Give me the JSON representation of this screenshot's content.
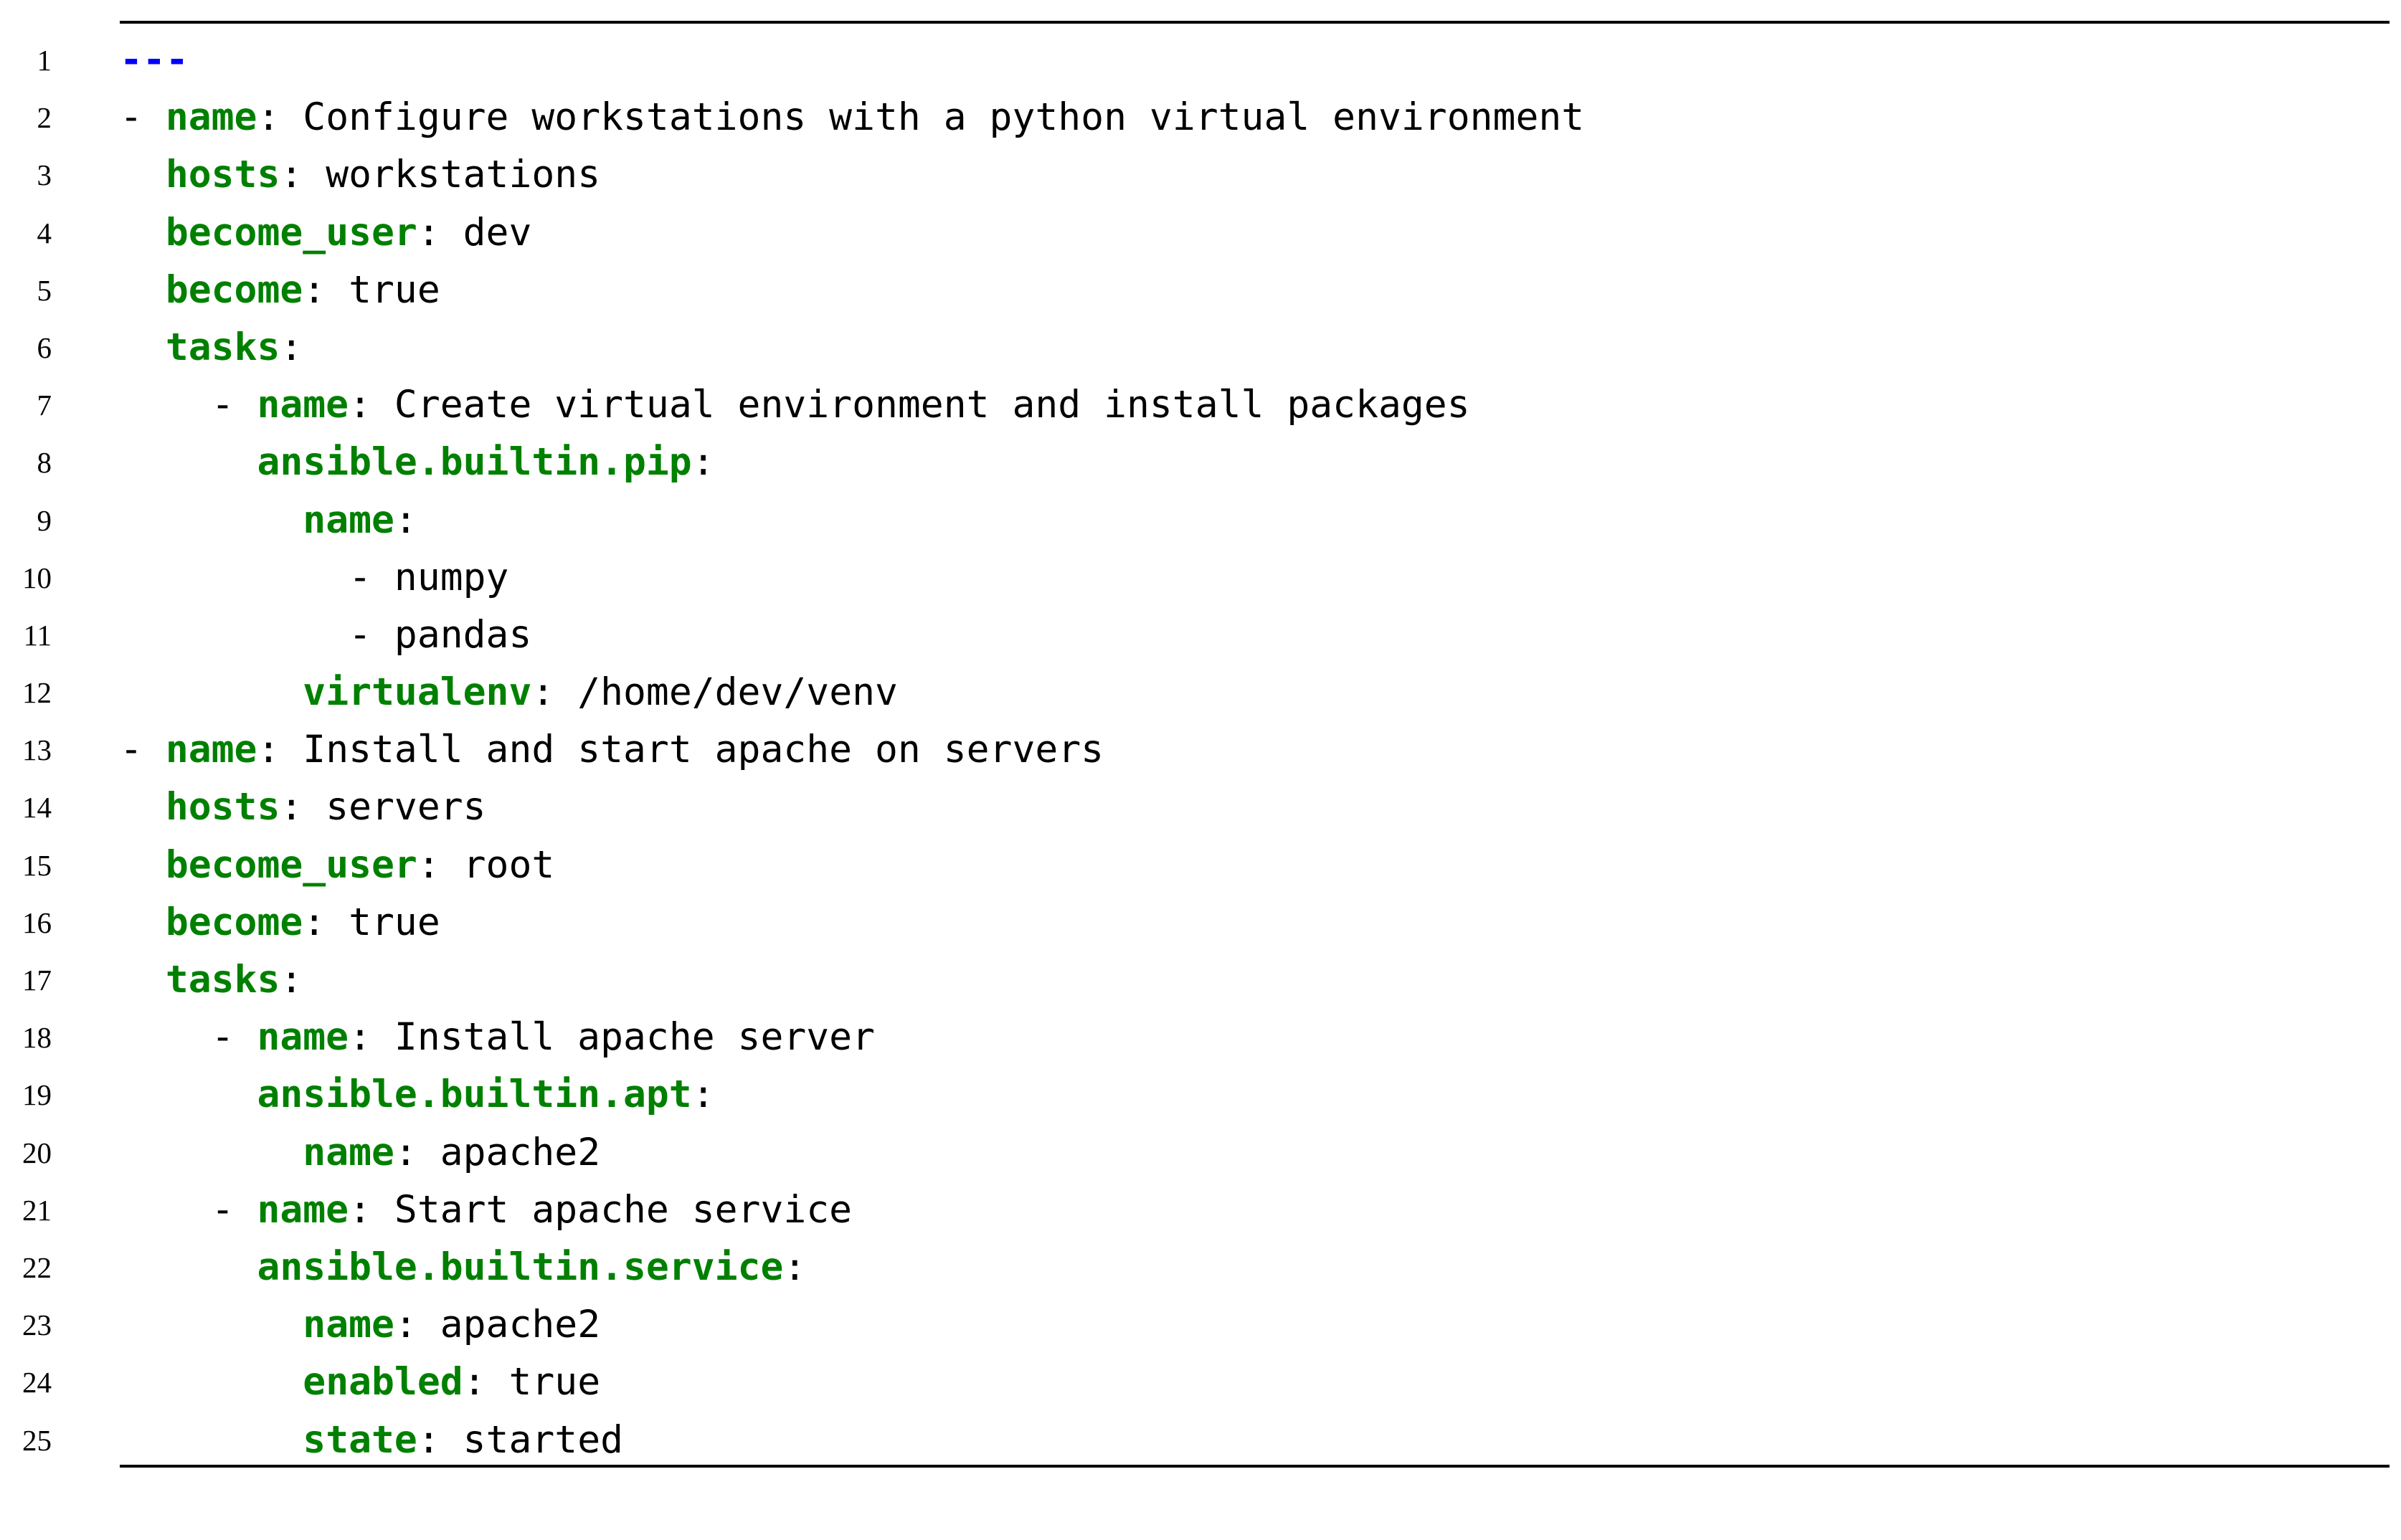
{
  "colors": {
    "key": "#008000",
    "document_marker": "#0000ff",
    "text": "#000000"
  },
  "code_listing": {
    "language": "yaml",
    "lines": [
      {
        "no": "1",
        "tokens": [
          {
            "t": "doc",
            "v": "---"
          }
        ]
      },
      {
        "no": "2",
        "tokens": [
          {
            "t": "plain",
            "v": "- "
          },
          {
            "t": "key",
            "v": "name"
          },
          {
            "t": "plain",
            "v": ": Configure workstations with a python virtual environment"
          }
        ]
      },
      {
        "no": "3",
        "tokens": [
          {
            "t": "plain",
            "v": "  "
          },
          {
            "t": "key",
            "v": "hosts"
          },
          {
            "t": "plain",
            "v": ": workstations"
          }
        ]
      },
      {
        "no": "4",
        "tokens": [
          {
            "t": "plain",
            "v": "  "
          },
          {
            "t": "key",
            "v": "become_user"
          },
          {
            "t": "plain",
            "v": ": dev"
          }
        ]
      },
      {
        "no": "5",
        "tokens": [
          {
            "t": "plain",
            "v": "  "
          },
          {
            "t": "key",
            "v": "become"
          },
          {
            "t": "plain",
            "v": ": true"
          }
        ]
      },
      {
        "no": "6",
        "tokens": [
          {
            "t": "plain",
            "v": "  "
          },
          {
            "t": "key",
            "v": "tasks"
          },
          {
            "t": "plain",
            "v": ":"
          }
        ]
      },
      {
        "no": "7",
        "tokens": [
          {
            "t": "plain",
            "v": "    - "
          },
          {
            "t": "key",
            "v": "name"
          },
          {
            "t": "plain",
            "v": ": Create virtual environment and install packages"
          }
        ]
      },
      {
        "no": "8",
        "tokens": [
          {
            "t": "plain",
            "v": "      "
          },
          {
            "t": "key",
            "v": "ansible.builtin.pip"
          },
          {
            "t": "plain",
            "v": ":"
          }
        ]
      },
      {
        "no": "9",
        "tokens": [
          {
            "t": "plain",
            "v": "        "
          },
          {
            "t": "key",
            "v": "name"
          },
          {
            "t": "plain",
            "v": ":"
          }
        ]
      },
      {
        "no": "10",
        "tokens": [
          {
            "t": "plain",
            "v": "          - numpy"
          }
        ]
      },
      {
        "no": "11",
        "tokens": [
          {
            "t": "plain",
            "v": "          - pandas"
          }
        ]
      },
      {
        "no": "12",
        "tokens": [
          {
            "t": "plain",
            "v": "        "
          },
          {
            "t": "key",
            "v": "virtualenv"
          },
          {
            "t": "plain",
            "v": ": /home/dev/venv"
          }
        ]
      },
      {
        "no": "13",
        "tokens": [
          {
            "t": "plain",
            "v": "- "
          },
          {
            "t": "key",
            "v": "name"
          },
          {
            "t": "plain",
            "v": ": Install and start apache on servers"
          }
        ]
      },
      {
        "no": "14",
        "tokens": [
          {
            "t": "plain",
            "v": "  "
          },
          {
            "t": "key",
            "v": "hosts"
          },
          {
            "t": "plain",
            "v": ": servers"
          }
        ]
      },
      {
        "no": "15",
        "tokens": [
          {
            "t": "plain",
            "v": "  "
          },
          {
            "t": "key",
            "v": "become_user"
          },
          {
            "t": "plain",
            "v": ": root"
          }
        ]
      },
      {
        "no": "16",
        "tokens": [
          {
            "t": "plain",
            "v": "  "
          },
          {
            "t": "key",
            "v": "become"
          },
          {
            "t": "plain",
            "v": ": true"
          }
        ]
      },
      {
        "no": "17",
        "tokens": [
          {
            "t": "plain",
            "v": "  "
          },
          {
            "t": "key",
            "v": "tasks"
          },
          {
            "t": "plain",
            "v": ":"
          }
        ]
      },
      {
        "no": "18",
        "tokens": [
          {
            "t": "plain",
            "v": "    - "
          },
          {
            "t": "key",
            "v": "name"
          },
          {
            "t": "plain",
            "v": ": Install apache server"
          }
        ]
      },
      {
        "no": "19",
        "tokens": [
          {
            "t": "plain",
            "v": "      "
          },
          {
            "t": "key",
            "v": "ansible.builtin.apt"
          },
          {
            "t": "plain",
            "v": ":"
          }
        ]
      },
      {
        "no": "20",
        "tokens": [
          {
            "t": "plain",
            "v": "        "
          },
          {
            "t": "key",
            "v": "name"
          },
          {
            "t": "plain",
            "v": ": apache2"
          }
        ]
      },
      {
        "no": "21",
        "tokens": [
          {
            "t": "plain",
            "v": "    - "
          },
          {
            "t": "key",
            "v": "name"
          },
          {
            "t": "plain",
            "v": ": Start apache service"
          }
        ]
      },
      {
        "no": "22",
        "tokens": [
          {
            "t": "plain",
            "v": "      "
          },
          {
            "t": "key",
            "v": "ansible.builtin.service"
          },
          {
            "t": "plain",
            "v": ":"
          }
        ]
      },
      {
        "no": "23",
        "tokens": [
          {
            "t": "plain",
            "v": "        "
          },
          {
            "t": "key",
            "v": "name"
          },
          {
            "t": "plain",
            "v": ": apache2"
          }
        ]
      },
      {
        "no": "24",
        "tokens": [
          {
            "t": "plain",
            "v": "        "
          },
          {
            "t": "key",
            "v": "enabled"
          },
          {
            "t": "plain",
            "v": ": true"
          }
        ]
      },
      {
        "no": "25",
        "tokens": [
          {
            "t": "plain",
            "v": "        "
          },
          {
            "t": "key",
            "v": "state"
          },
          {
            "t": "plain",
            "v": ": started"
          }
        ]
      }
    ]
  }
}
